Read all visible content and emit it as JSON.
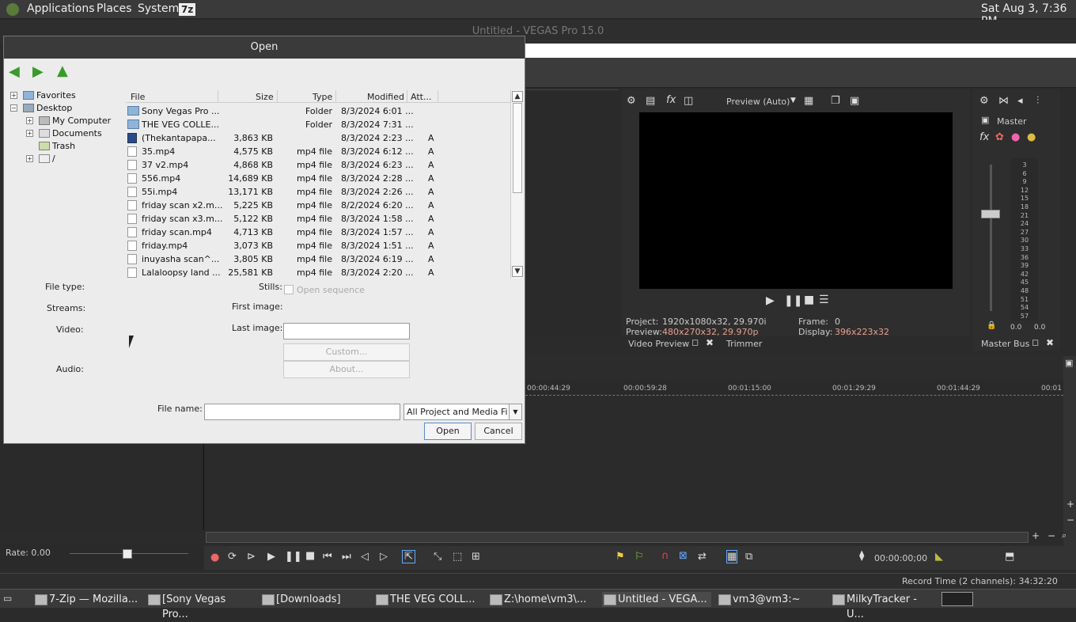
{
  "topbar": {
    "applications": "Applications",
    "places": "Places",
    "system": "System",
    "zip_badge": "7z",
    "clock": "Sat Aug  3,  7:36 PM"
  },
  "vegas": {
    "title": "Untitled - VEGAS Pro 15.0",
    "preview_quality": "Preview (Auto)",
    "master_label": "Master",
    "project_label": "Project:",
    "project_value": "1920x1080x32, 29.970i",
    "preview_label": "Preview:",
    "preview_value": "480x270x32, 29.970p",
    "frame_label": "Frame:",
    "frame_value": "0",
    "display_label": "Display:",
    "display_value": "396x223x32",
    "video_preview_tab": "Video Preview",
    "trimmer_tab": "Trimmer",
    "master_bus_tab": "Master Bus",
    "meter_ticks": [
      "3",
      "6",
      "9",
      "12",
      "15",
      "18",
      "21",
      "24",
      "27",
      "30",
      "33",
      "36",
      "39",
      "42",
      "45",
      "48",
      "51",
      "54",
      "57"
    ],
    "meter_left": "0.0",
    "meter_right": "0.0",
    "ruler": [
      "00:00:44:29",
      "00:00:59:28",
      "00:01:15:00",
      "00:01:29:29",
      "00:01:44:29",
      "00:01"
    ],
    "rate": "Rate: 0.00",
    "timecode": "00:00:00;00",
    "record_time": "Record Time (2 channels): 34:32:20"
  },
  "dialog": {
    "title": "Open",
    "tree": {
      "favorites": "Favorites",
      "desktop": "Desktop",
      "my_computer": "My Computer",
      "documents": "Documents",
      "trash": "Trash",
      "root": "/"
    },
    "columns": {
      "file": "File",
      "size": "Size",
      "type": "Type",
      "modified": "Modified",
      "attr": "Att..."
    },
    "files": [
      {
        "name": "Sony Vegas Pro ...",
        "size": "",
        "type": "Folder",
        "modified": "8/3/2024 6:01 ...",
        "attr": "",
        "icon": "folder"
      },
      {
        "name": "THE VEG COLLE...",
        "size": "",
        "type": "Folder",
        "modified": "8/3/2024 7:31 ...",
        "attr": "",
        "icon": "folder"
      },
      {
        "name": "(Thekantapapa...",
        "size": "3,863 KB",
        "type": "",
        "modified": "8/3/2024 2:23 ...",
        "attr": "A",
        "icon": "vid"
      },
      {
        "name": "35.mp4",
        "size": "4,575 KB",
        "type": "mp4 file",
        "modified": "8/3/2024 6:12 ...",
        "attr": "A",
        "icon": "file"
      },
      {
        "name": "37 v2.mp4",
        "size": "4,868 KB",
        "type": "mp4 file",
        "modified": "8/3/2024 6:23 ...",
        "attr": "A",
        "icon": "file"
      },
      {
        "name": "556.mp4",
        "size": "14,689 KB",
        "type": "mp4 file",
        "modified": "8/3/2024 2:28 ...",
        "attr": "A",
        "icon": "file"
      },
      {
        "name": "55i.mp4",
        "size": "13,171 KB",
        "type": "mp4 file",
        "modified": "8/3/2024 2:26 ...",
        "attr": "A",
        "icon": "file"
      },
      {
        "name": "friday scan x2.m...",
        "size": "5,225 KB",
        "type": "mp4 file",
        "modified": "8/2/2024 6:20 ...",
        "attr": "A",
        "icon": "file"
      },
      {
        "name": "friday scan x3.m...",
        "size": "5,122 KB",
        "type": "mp4 file",
        "modified": "8/3/2024 1:58 ...",
        "attr": "A",
        "icon": "file"
      },
      {
        "name": "friday scan.mp4",
        "size": "4,713 KB",
        "type": "mp4 file",
        "modified": "8/3/2024 1:57 ...",
        "attr": "A",
        "icon": "file"
      },
      {
        "name": "friday.mp4",
        "size": "3,073 KB",
        "type": "mp4 file",
        "modified": "8/3/2024 1:51 ...",
        "attr": "A",
        "icon": "file"
      },
      {
        "name": "inuyasha scan^...",
        "size": "3,805 KB",
        "type": "mp4 file",
        "modified": "8/3/2024 6:19 ...",
        "attr": "A",
        "icon": "file"
      },
      {
        "name": "Lalaloopsy land ...",
        "size": "25,581 KB",
        "type": "mp4 file",
        "modified": "8/3/2024 2:20 ...",
        "attr": "A",
        "icon": "file"
      }
    ],
    "file_type_label": "File type:",
    "streams_label": "Streams:",
    "video_label": "Video:",
    "audio_label": "Audio:",
    "stills_label": "Stills:",
    "open_sequence_label": "Open sequence",
    "first_image_label": "First image:",
    "last_image_label": "Last image:",
    "custom_button": "Custom...",
    "about_button": "About...",
    "file_name_label": "File name:",
    "file_name_value": "",
    "filter_value": "All Project and Media Files",
    "open_button": "Open",
    "cancel_button": "Cancel"
  },
  "taskbar": [
    "7-Zip — Mozilla...",
    "[Sony Vegas Pro...",
    "[Downloads]",
    "THE VEG COLL...",
    "Z:\\home\\vm3\\...",
    "Untitled - VEGA...",
    "vm3@vm3:~",
    "MilkyTracker - U..."
  ]
}
